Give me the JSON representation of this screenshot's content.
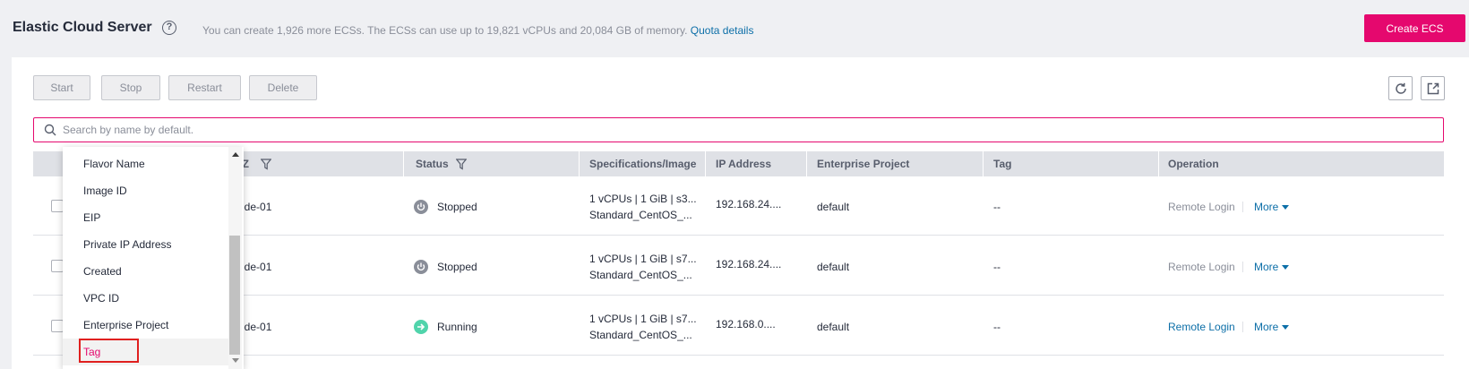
{
  "header": {
    "title": "Elastic Cloud Server",
    "help_symbol": "?",
    "quota_text": "You can create 1,926 more ECSs. The ECSs can use up to 19,821 vCPUs and 20,084 GB of memory.",
    "quota_link": "Quota details",
    "create_label": "Create ECS"
  },
  "toolbar": {
    "start": "Start",
    "stop": "Stop",
    "restart": "Restart",
    "delete": "Delete"
  },
  "search": {
    "placeholder": "Search by name by default."
  },
  "table": {
    "columns": {
      "az": "AZ",
      "status": "Status",
      "specs": "Specifications/Image",
      "ip": "IP Address",
      "project": "Enterprise Project",
      "tag": "Tag",
      "operation": "Operation"
    },
    "rows": [
      {
        "az": "u-de-01",
        "status": "Stopped",
        "spec1": "1 vCPUs | 1 GiB | s3...",
        "spec2": "Standard_CentOS_...",
        "ip": "192.168.24....",
        "project": "default",
        "tag": "--",
        "remote": "Remote Login",
        "more": "More"
      },
      {
        "az": "u-de-01",
        "status": "Stopped",
        "spec1": "1 vCPUs | 1 GiB | s7...",
        "spec2": "Standard_CentOS_...",
        "ip": "192.168.24....",
        "project": "default",
        "tag": "--",
        "remote": "Remote Login",
        "more": "More"
      },
      {
        "az": "u-de-01",
        "status": "Running",
        "spec1": "1 vCPUs | 1 GiB | s7...",
        "spec2": "Standard_CentOS_...",
        "ip": "192.168.0....",
        "project": "default",
        "tag": "--",
        "remote": "Remote Login",
        "more": "More"
      }
    ]
  },
  "dropdown": {
    "items": [
      "Flavor Name",
      "Image ID",
      "EIP",
      "Private IP Address",
      "Created",
      "VPC ID",
      "Enterprise Project",
      "Tag"
    ]
  },
  "colors": {
    "accent": "#e5086e",
    "link": "#0d6fa8",
    "stopped": "#8a8e99",
    "running": "#50d4ab",
    "highlight": "#e0201f"
  }
}
